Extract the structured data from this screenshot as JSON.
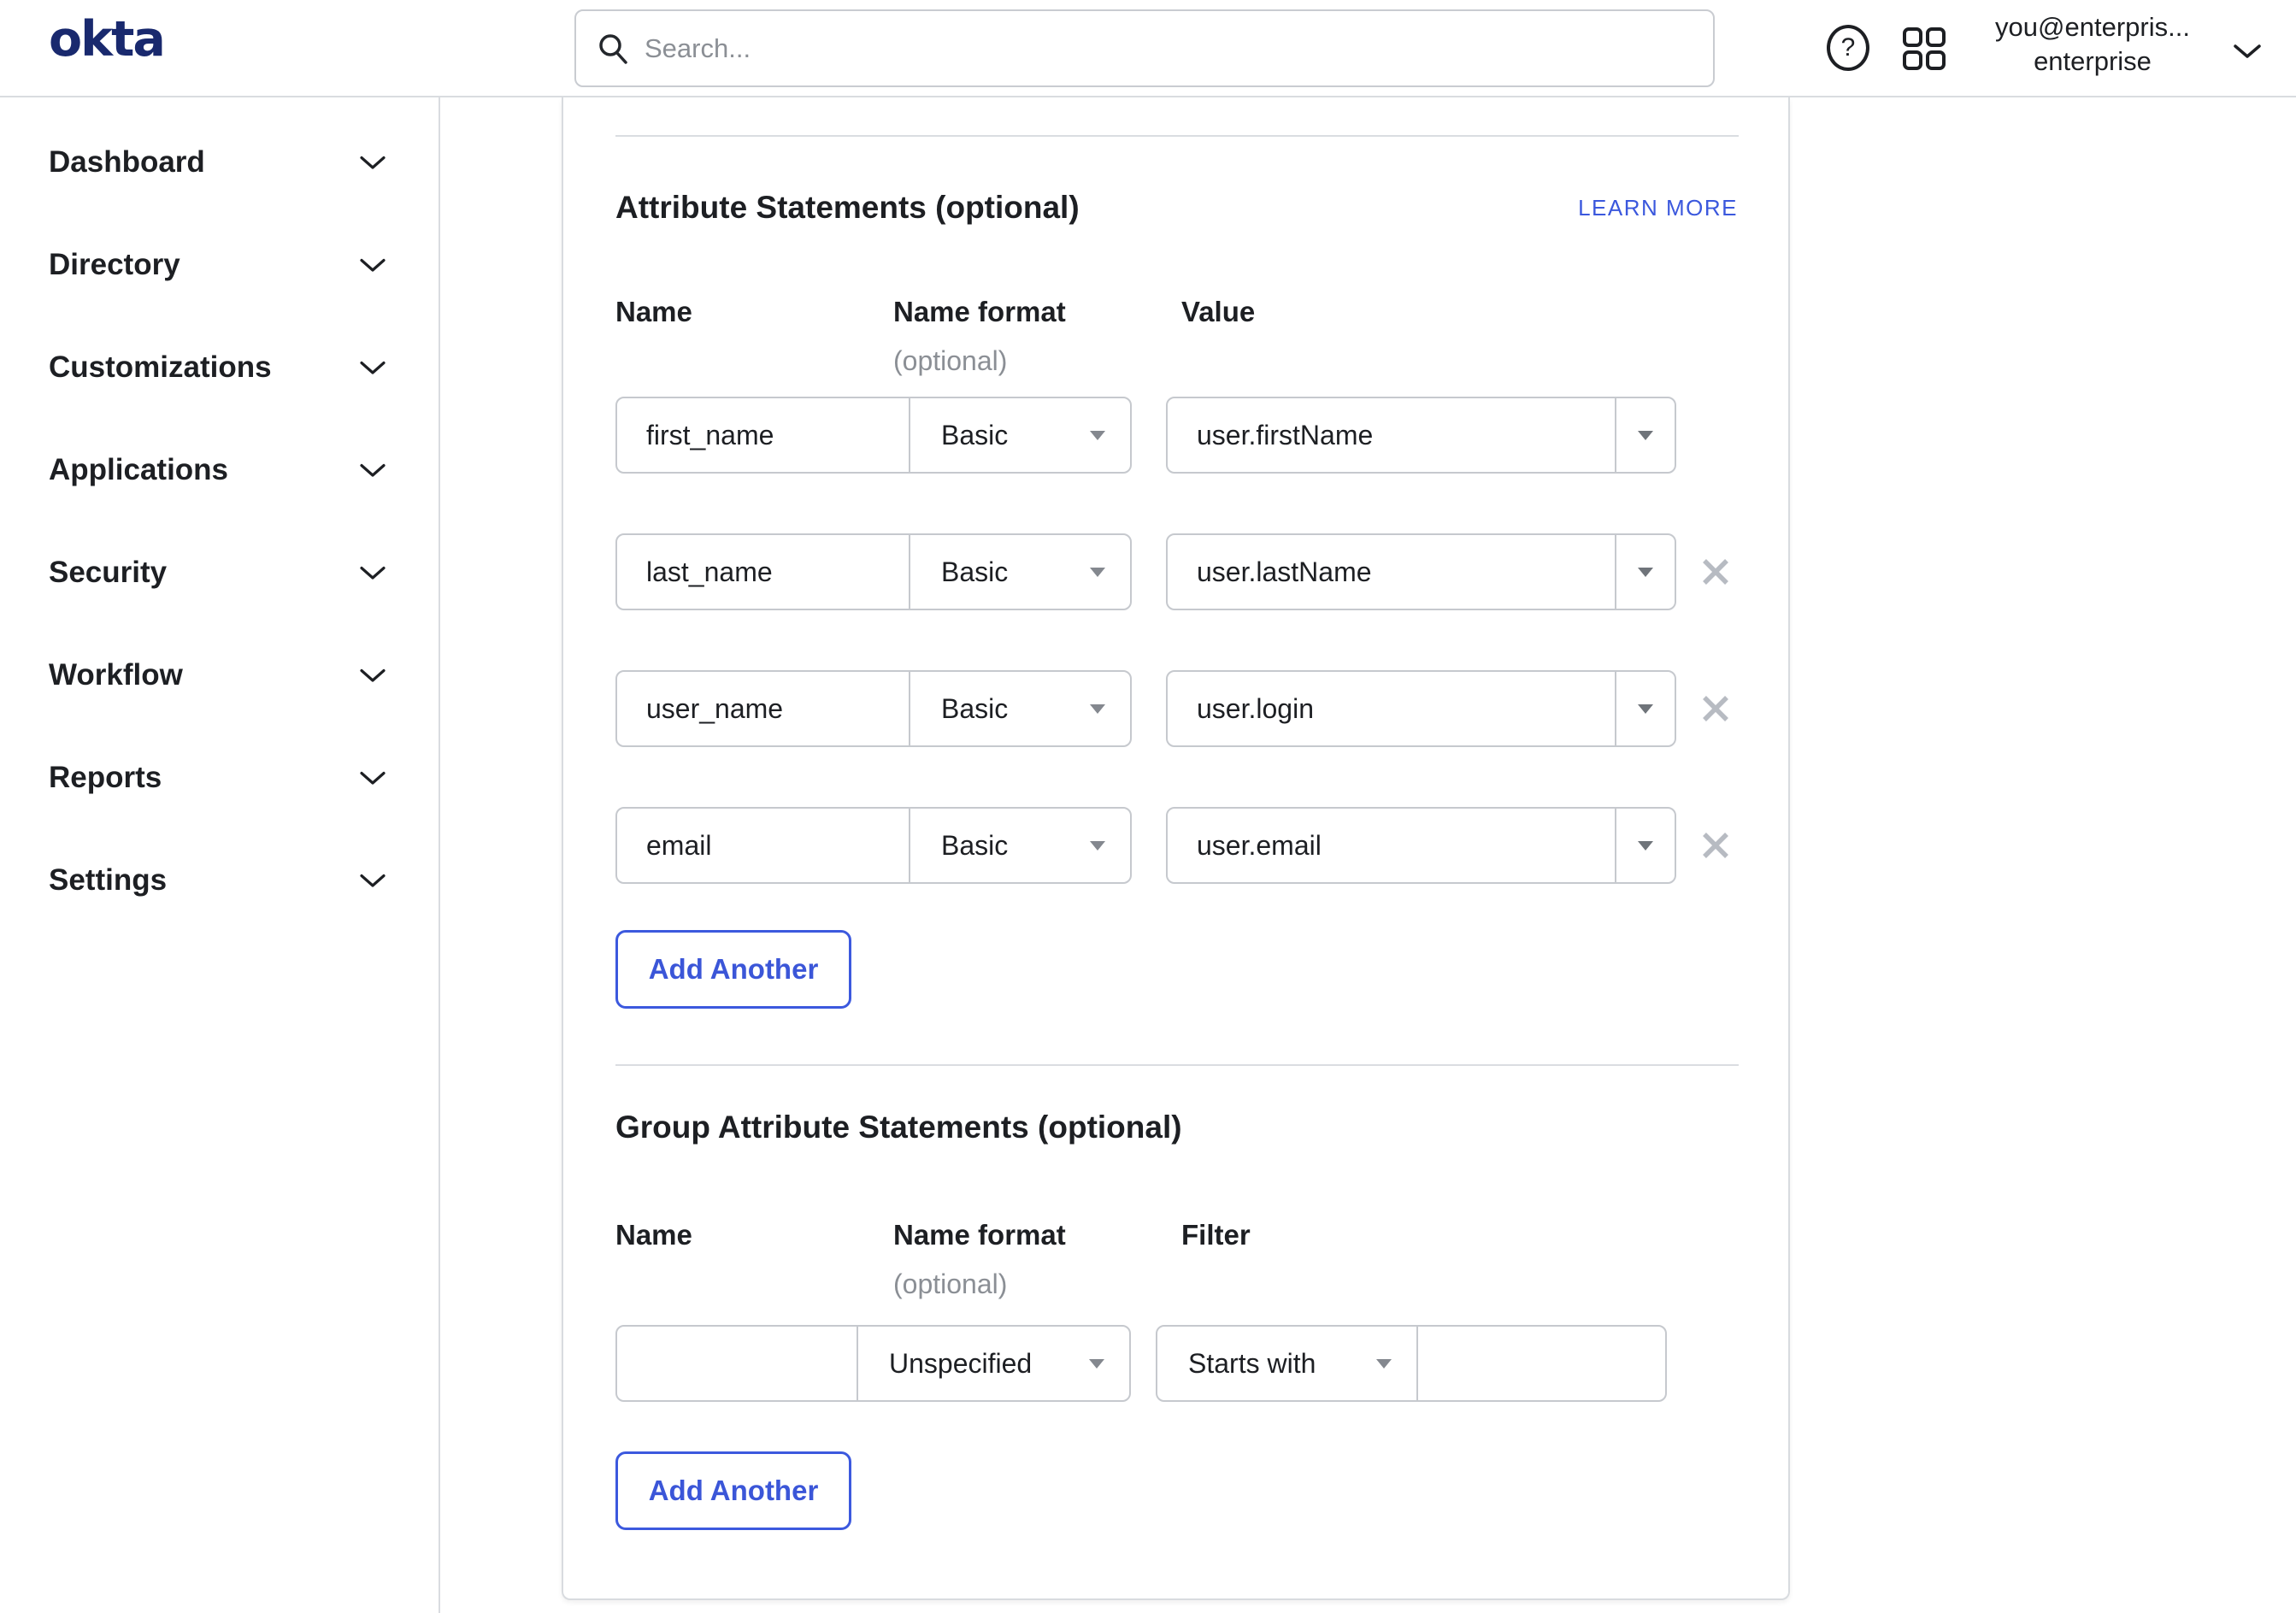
{
  "header": {
    "logo_text": "okta",
    "search": {
      "placeholder": "Search..."
    },
    "help_glyph": "?",
    "account": {
      "email": "you@enterpris...",
      "org": "enterprise"
    }
  },
  "sidebar": {
    "items": [
      {
        "label": "Dashboard"
      },
      {
        "label": "Directory"
      },
      {
        "label": "Customizations"
      },
      {
        "label": "Applications"
      },
      {
        "label": "Security"
      },
      {
        "label": "Workflow"
      },
      {
        "label": "Reports"
      },
      {
        "label": "Settings"
      }
    ]
  },
  "attribute_section": {
    "title": "Attribute Statements (optional)",
    "learn_more_label": "LEARN MORE",
    "columns": {
      "name": "Name",
      "name_format": "Name format",
      "name_format_note": "(optional)",
      "value": "Value"
    },
    "rows": [
      {
        "name": "first_name",
        "format": "Basic",
        "value": "user.firstName"
      },
      {
        "name": "last_name",
        "format": "Basic",
        "value": "user.lastName"
      },
      {
        "name": "user_name",
        "format": "Basic",
        "value": "user.login"
      },
      {
        "name": "email",
        "format": "Basic",
        "value": "user.email"
      }
    ],
    "add_button_label": "Add Another"
  },
  "group_section": {
    "title": "Group Attribute Statements (optional)",
    "columns": {
      "name": "Name",
      "name_format": "Name format",
      "name_format_note": "(optional)",
      "filter": "Filter"
    },
    "rows": [
      {
        "name": "",
        "format": "Unspecified",
        "filter_type": "Starts with",
        "filter_value": ""
      }
    ],
    "add_button_label": "Add Another"
  },
  "colors": {
    "accent_blue": "#3C59DE",
    "logo_navy": "#19296E",
    "text_dark": "#1D1F23",
    "muted_gray": "#8B8F95",
    "input_border": "#C6C9CE",
    "icon_gray": "#B7BBC2"
  }
}
